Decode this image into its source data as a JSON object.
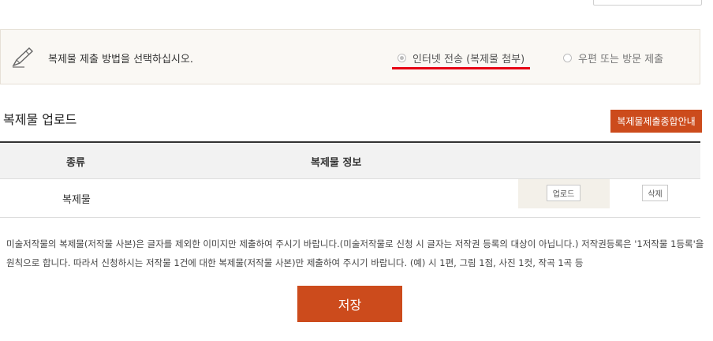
{
  "method": {
    "label": "복제물 제출 방법을 선택하십시오.",
    "options": [
      {
        "label": "인터넷 전송 (복제물 첨부)",
        "selected": true
      },
      {
        "label": "우편 또는 방문 제출",
        "selected": false
      }
    ]
  },
  "section": {
    "title": "복제물 업로드",
    "guide_button": "복제물제출종합안내"
  },
  "table": {
    "headers": {
      "type": "종류",
      "info": "복제물 정보"
    },
    "rows": [
      {
        "type": "복제물",
        "upload_label": "업로드",
        "delete_label": "삭제"
      }
    ]
  },
  "notice": {
    "text": "미술저작물의 복제물(저작물 사본)은 글자를 제외한 이미지만 제출하여 주시기 바랍니다.(미술저작물로 신청 시 글자는 저작권 등록의 대상이 아닙니다.) 저작권등록은 '1저작물 1등록'을 원칙으로 합니다. 따라서 신청하시는 저작물 1건에 대한 복제물(저작물 사본)만 제출하여 주시기 바랍니다. (예) 시 1편, 그림 1점, 사진 1컷, 작곡 1곡 등"
  },
  "save_button": "저장",
  "colors": {
    "accent": "#cc4b1c",
    "highlight": "#e60012",
    "panel_bg": "#faf8f4"
  }
}
